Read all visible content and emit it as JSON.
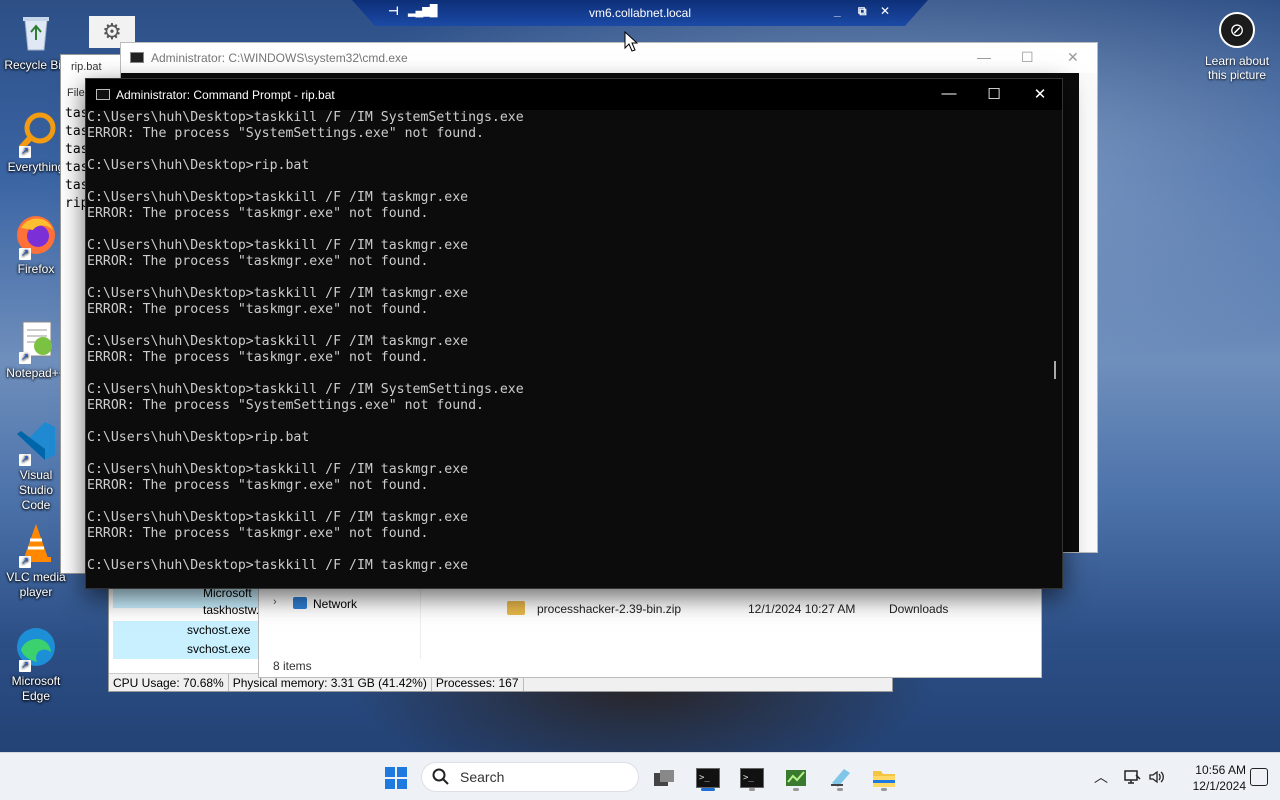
{
  "rdp": {
    "title": "vm6.collabnet.local",
    "pin": "⊣",
    "signal": "▂▄▆█",
    "minimize": "_",
    "restore": "⧉",
    "close": "✕"
  },
  "desktop_icons": [
    {
      "label": "Recycle Bin",
      "icon": "recycle-bin-icon"
    },
    {
      "label": "Everything",
      "icon": "everything-icon"
    },
    {
      "label": "Firefox",
      "icon": "firefox-icon"
    },
    {
      "label": "Notepad++",
      "icon": "notepad-plus-plus-icon"
    },
    {
      "label": "Visual Studio Code",
      "icon": "vscode-icon"
    },
    {
      "label": "VLC media player",
      "icon": "vlc-icon"
    },
    {
      "label": "Microsoft Edge",
      "icon": "edge-icon"
    }
  ],
  "learn": {
    "label": "Learn about this picture"
  },
  "notepad": {
    "tab": "rip.bat",
    "menu": "File",
    "lines": [
      "tas",
      "tas",
      "tas",
      "tas",
      "tas",
      "rip"
    ]
  },
  "cmd_back": {
    "title": "Administrator: C:\\WINDOWS\\system32\\cmd.exe",
    "minimize": "—",
    "maximize": "☐",
    "close": "✕"
  },
  "cmd_front": {
    "title": "Administrator: Command Prompt - rip.bat",
    "minimize": "—",
    "maximize": "☐",
    "close": "✕",
    "lines": [
      "C:\\Users\\huh\\Desktop>taskkill /F /IM SystemSettings.exe",
      "ERROR: The process \"SystemSettings.exe\" not found.",
      "",
      "C:\\Users\\huh\\Desktop>rip.bat",
      "",
      "C:\\Users\\huh\\Desktop>taskkill /F /IM taskmgr.exe",
      "ERROR: The process \"taskmgr.exe\" not found.",
      "",
      "C:\\Users\\huh\\Desktop>taskkill /F /IM taskmgr.exe",
      "ERROR: The process \"taskmgr.exe\" not found.",
      "",
      "C:\\Users\\huh\\Desktop>taskkill /F /IM taskmgr.exe",
      "ERROR: The process \"taskmgr.exe\" not found.",
      "",
      "C:\\Users\\huh\\Desktop>taskkill /F /IM taskmgr.exe",
      "ERROR: The process \"taskmgr.exe\" not found.",
      "",
      "C:\\Users\\huh\\Desktop>taskkill /F /IM SystemSettings.exe",
      "ERROR: The process \"SystemSettings.exe\" not found.",
      "",
      "C:\\Users\\huh\\Desktop>rip.bat",
      "",
      "C:\\Users\\huh\\Desktop>taskkill /F /IM taskmgr.exe",
      "ERROR: The process \"taskmgr.exe\" not found.",
      "",
      "C:\\Users\\huh\\Desktop>taskkill /F /IM taskmgr.exe",
      "ERROR: The process \"taskmgr.exe\" not found.",
      "",
      "C:\\Users\\huh\\Desktop>taskkill /F /IM taskmgr.exe"
    ]
  },
  "process_hacker": {
    "rows": [
      "Microsoft",
      "taskhostw.",
      "svchost.exe",
      "svchost.exe"
    ],
    "status": {
      "cpu": "CPU Usage: 70.68%",
      "memory": "Physical memory: 3.31 GB (41.42%)",
      "processes": "Processes: 167"
    }
  },
  "explorer": {
    "nav_item": "Network",
    "file": {
      "name": "processhacker-2.39-bin.zip",
      "date": "12/1/2024 10:27 AM",
      "location": "Downloads"
    },
    "item_count": "8 items"
  },
  "taskbar": {
    "search_placeholder": "Search",
    "clock_time": "10:56 AM",
    "clock_date": "12/1/2024",
    "apps": [
      "task-view-icon",
      "cmd-icon",
      "cmd-icon",
      "process-hacker-icon",
      "files-icon",
      "file-explorer-icon"
    ]
  },
  "colors": {
    "accent": "#1f7ae0",
    "console_bg": "#0c0c0c",
    "console_fg": "#cccccc",
    "selection": "#c8f0ff",
    "rdp_bar": "#1b4aa6"
  }
}
